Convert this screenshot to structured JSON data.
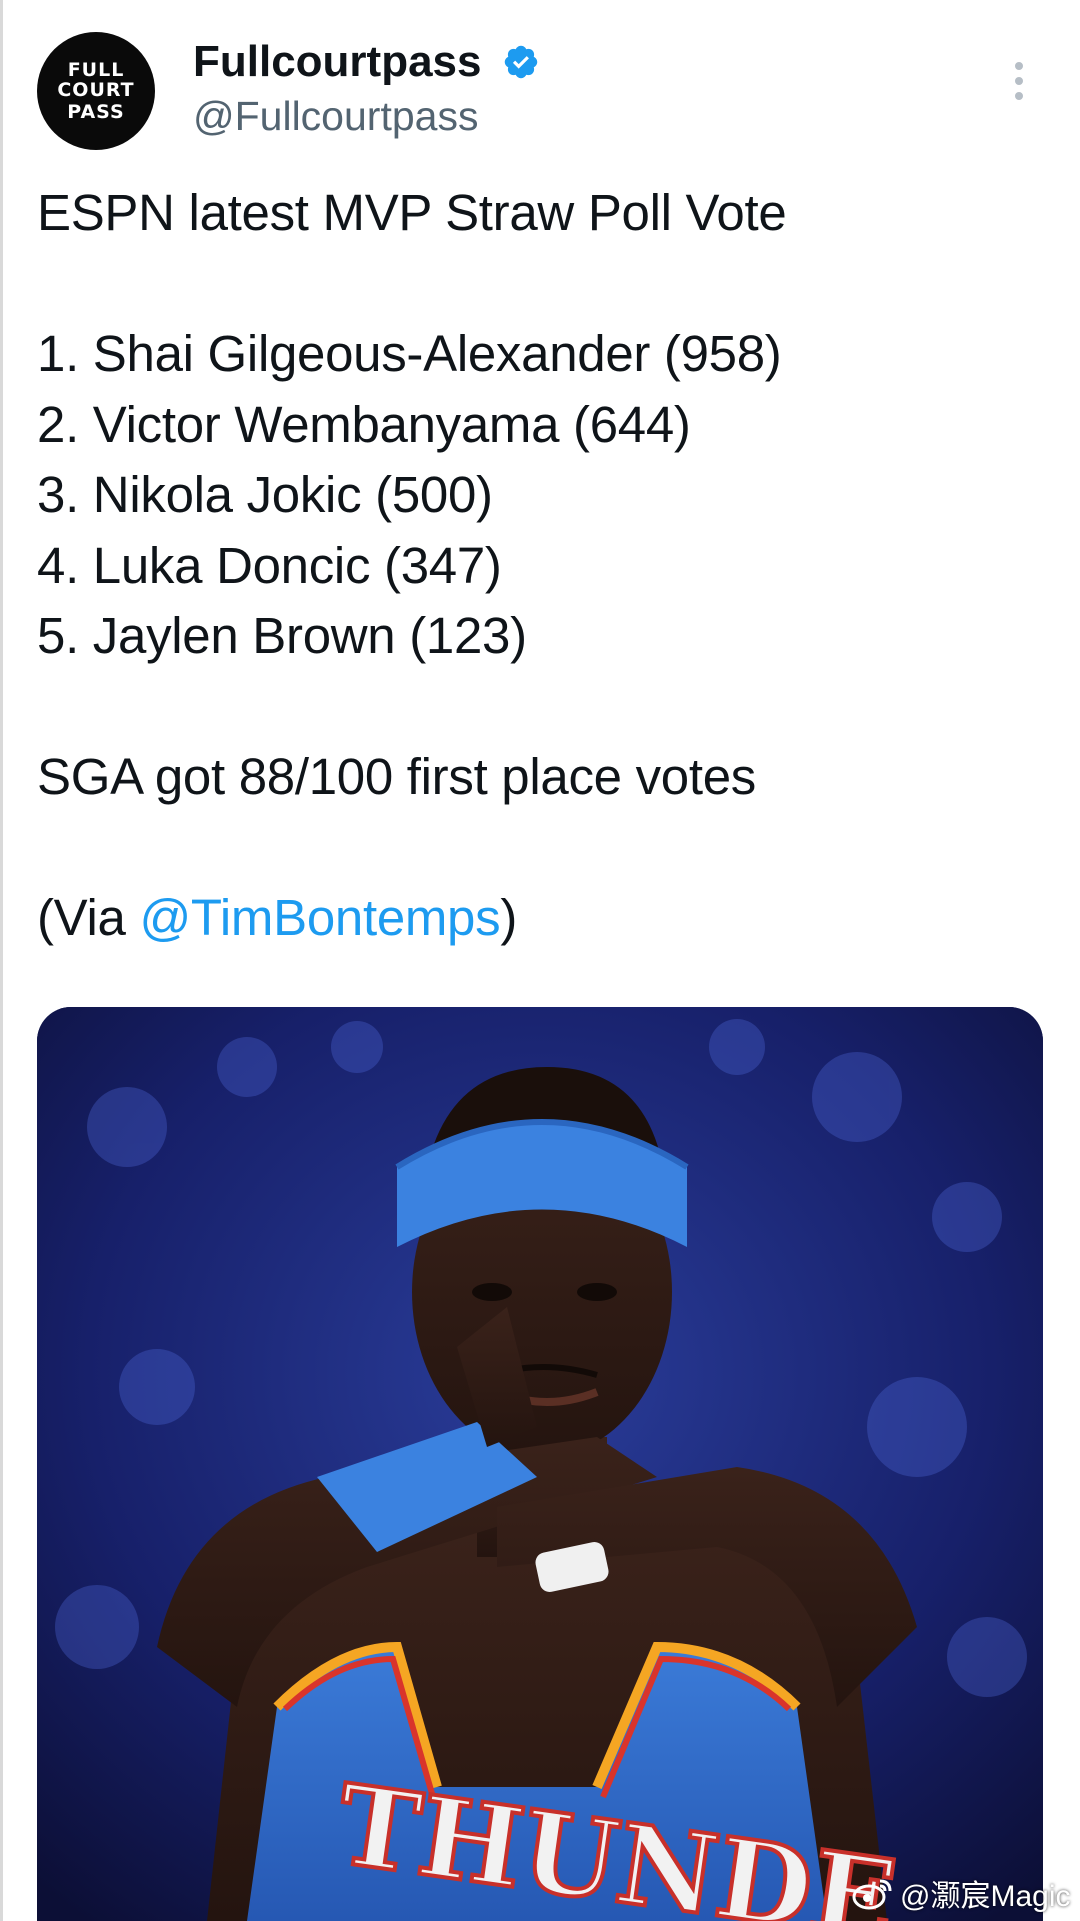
{
  "tweet": {
    "author": {
      "display_name": "Fullcourtpass",
      "handle": "@Fullcourtpass",
      "verified": true,
      "avatar_logo": [
        "FULL",
        "COURT",
        "PASS"
      ]
    },
    "more_options_icon": "vertical-ellipsis-icon",
    "text": {
      "headline": "ESPN latest MVP Straw Poll Vote",
      "ranking": [
        "1. Shai Gilgeous-Alexander (958)",
        "2. Victor Wembanyama (644)",
        "3. Nikola Jokic (500)",
        "4. Luka Doncic (347)",
        "5. Jaylen Brown (123)"
      ],
      "note": "SGA got 88/100 first place votes",
      "via_prefix": "(Via ",
      "via_mention": "@TimBontemps",
      "via_suffix": ")"
    },
    "media": {
      "jersey_text": "THUNDE"
    }
  },
  "watermark": {
    "text": "@灏宸Magic",
    "icon": "weibo-icon"
  },
  "colors": {
    "link": "#1d9bf0",
    "secondary_text": "#536471",
    "verified_badge": "#1d9bf0",
    "jersey_blue": "#2f6fd1",
    "headband_blue": "#3b82e0"
  }
}
